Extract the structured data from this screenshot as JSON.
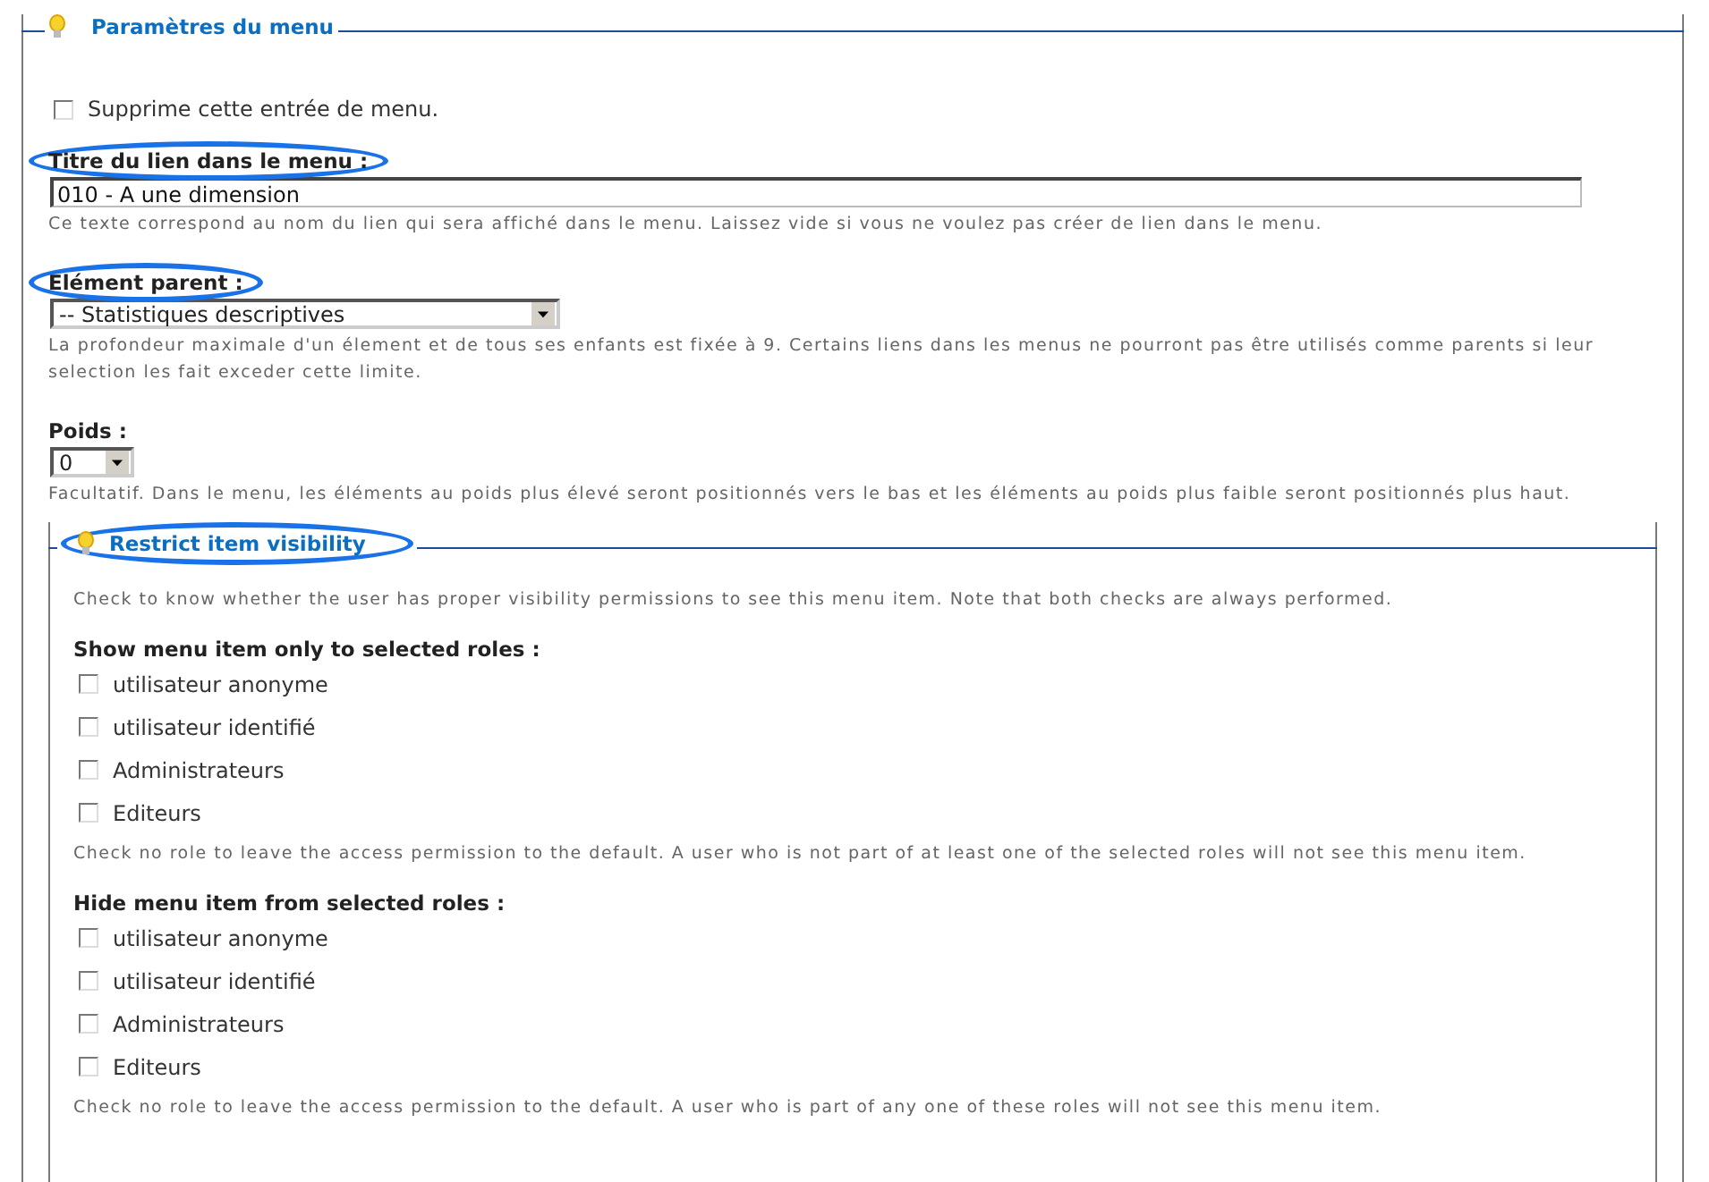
{
  "fieldset": {
    "legend": "Paramètres du menu",
    "delete_checkbox": {
      "label": "Supprime cette entrée de menu.",
      "checked": false
    },
    "fields": [
      {
        "kind": "text",
        "label": "Titre du lien dans le menu :",
        "highlighted": true,
        "value": "010 - A une dimension",
        "help": "Ce texte correspond au nom du lien qui sera affiché dans le menu. Laissez vide si vous ne voulez pas créer de lien dans le menu."
      },
      {
        "kind": "select",
        "label": "Elément parent :",
        "highlighted": true,
        "value": "-- Statistiques descriptives",
        "help": "La profondeur maximale d'un élement et de tous ses enfants est fixée à 9. Certains liens dans les menus ne pourront pas être utilisés comme parents si leur selection les fait exceder cette limite."
      },
      {
        "kind": "small-select",
        "label": "Poids :",
        "highlighted": false,
        "value": "0",
        "help": "Facultatif. Dans le menu, les éléments au poids plus élevé seront positionnés vers le bas et les éléments au poids plus faible seront positionnés plus haut."
      }
    ],
    "inner": {
      "legend": "Restrict item visibility",
      "highlighted": true,
      "description": "Check to know whether the user has proper visibility permissions to see this menu item. Note that both checks are always performed.",
      "groups": [
        {
          "heading": "Show menu item only to selected roles :",
          "roles": [
            {
              "label": "utilisateur anonyme",
              "checked": false
            },
            {
              "label": "utilisateur identifié",
              "checked": false
            },
            {
              "label": "Administrateurs",
              "checked": false
            },
            {
              "label": "Editeurs",
              "checked": false
            }
          ],
          "help": "Check no role to leave the access permission to the default. A user who is not part of at least one of the selected roles will not see this menu item."
        },
        {
          "heading": "Hide menu item from selected roles :",
          "roles": [
            {
              "label": "utilisateur anonyme",
              "checked": false
            },
            {
              "label": "utilisateur identifié",
              "checked": false
            },
            {
              "label": "Administrateurs",
              "checked": false
            },
            {
              "label": "Editeurs",
              "checked": false
            }
          ],
          "help": "Check no role to leave the access permission to the default. A user who is part of any one of these roles will not see this menu item."
        }
      ]
    }
  }
}
